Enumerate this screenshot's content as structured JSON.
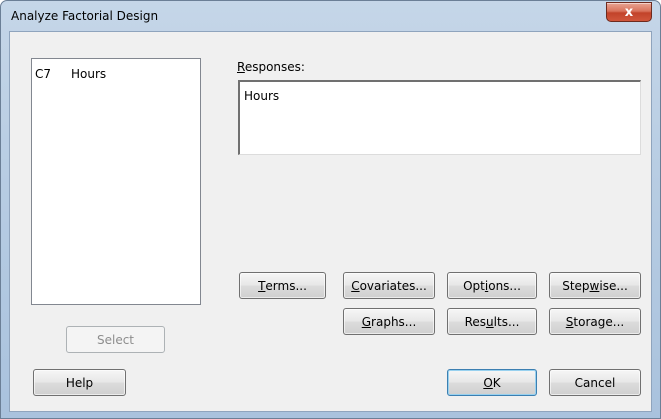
{
  "window": {
    "title": "Analyze Factorial Design",
    "close_glyph": "x"
  },
  "variables": {
    "items": [
      {
        "column": "C7",
        "name": "Hours"
      }
    ]
  },
  "responses": {
    "label": "Responses:",
    "mnemonic": "R",
    "value": "Hours"
  },
  "buttons": {
    "terms": {
      "pre": "",
      "u": "T",
      "post": "erms..."
    },
    "covariates": {
      "pre": "",
      "u": "C",
      "post": "ovariates..."
    },
    "options": {
      "pre": "Opt",
      "u": "i",
      "post": "ons..."
    },
    "stepwise": {
      "pre": "Step",
      "u": "w",
      "post": "ise..."
    },
    "graphs": {
      "pre": "",
      "u": "G",
      "post": "raphs..."
    },
    "results": {
      "pre": "Res",
      "u": "u",
      "post": "lts..."
    },
    "storage": {
      "pre": "",
      "u": "S",
      "post": "torage..."
    },
    "select": "Select",
    "help": "Help",
    "ok": {
      "pre": "",
      "u": "O",
      "post": "K"
    },
    "cancel": "Cancel"
  },
  "colors": {
    "title_bar": "#b8cde3",
    "close_button": "#c2432a",
    "dialog_bg": "#f0f0f0",
    "default_button_border": "#3c7fb1"
  }
}
